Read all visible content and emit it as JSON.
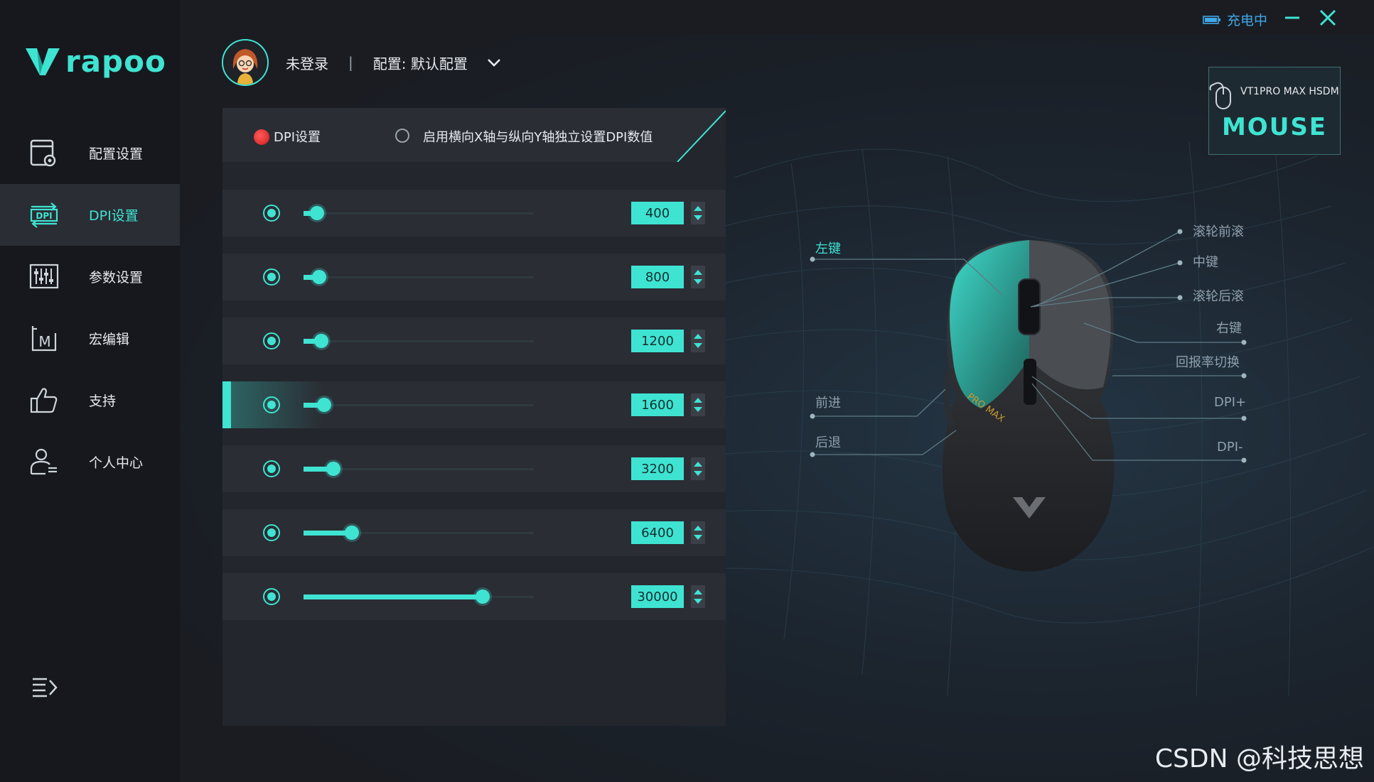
{
  "app": {
    "brand": "rapoo",
    "charging_status": "充电中",
    "colors": {
      "accent": "#3fe3d2",
      "sidebar_bg": "#16181d",
      "active_row": "#2a2d34",
      "red_radio": "#e32626"
    }
  },
  "sidebar": {
    "items": [
      {
        "label": "配置设置",
        "icon": "profile-settings-icon"
      },
      {
        "label": "DPI设置",
        "icon": "dpi-icon"
      },
      {
        "label": "参数设置",
        "icon": "sliders-icon"
      },
      {
        "label": "宏编辑",
        "icon": "macro-icon"
      },
      {
        "label": "支持",
        "icon": "thumbs-up-icon"
      },
      {
        "label": "个人中心",
        "icon": "user-center-icon"
      }
    ],
    "active_index": 1
  },
  "header": {
    "user_name": "未登录",
    "separator": "|",
    "config": "配置: 默认配置"
  },
  "dpi_panel": {
    "mode_dpi": "DPI设置",
    "mode_xy": "启用横向X轴与纵向Y轴独立设置DPI数值",
    "active_row": 3,
    "rows": [
      {
        "value": "400",
        "level": 0.04
      },
      {
        "value": "800",
        "level": 0.05
      },
      {
        "value": "1200",
        "level": 0.06
      },
      {
        "value": "1600",
        "level": 0.07
      },
      {
        "value": "3200",
        "level": 0.11
      },
      {
        "value": "6400",
        "level": 0.19
      },
      {
        "value": "30000",
        "level": 0.76
      }
    ]
  },
  "device": {
    "name": "VT1PRO MAX HSDM",
    "type": "MOUSE",
    "model_text": "PRO MAX"
  },
  "mouse_labels": {
    "left_click": "左键",
    "forward": "前进",
    "back": "后退",
    "wheel_up": "滚轮前滚",
    "middle": "中键",
    "wheel_down": "滚轮后滚",
    "right_click": "右键",
    "report_rate": "回报率切换",
    "dpi_plus": "DPI+",
    "dpi_minus": "DPI-"
  },
  "watermark": "CSDN @科技思想"
}
